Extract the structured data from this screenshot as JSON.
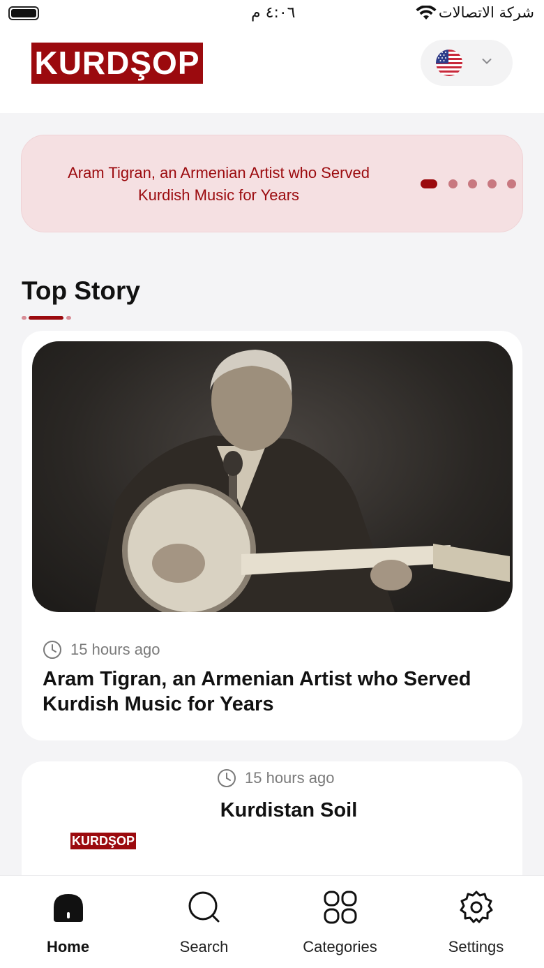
{
  "status_bar": {
    "time": "٤:٠٦ م",
    "carrier": "شركة الاتصالات"
  },
  "header": {
    "logo_text": "KURDŞOP",
    "language_flag": "us-flag-icon"
  },
  "banner": {
    "text": "Aram Tigran, an Armenian Artist who Served Kurdish Music for Years",
    "dots_count": 5,
    "active_dot": 0
  },
  "section": {
    "title": "Top Story"
  },
  "stories": [
    {
      "time": "15 hours ago",
      "title": "Aram Tigran, an Armenian Artist who Served Kurdish Music for Years"
    },
    {
      "time": "15 hours ago",
      "title": "Kurdistan Soil",
      "logo_text": "KURDŞOP"
    }
  ],
  "tabs": [
    {
      "label": "Home",
      "icon": "home-icon",
      "active": true
    },
    {
      "label": "Search",
      "icon": "search-icon",
      "active": false
    },
    {
      "label": "Categories",
      "icon": "categories-icon",
      "active": false
    },
    {
      "label": "Settings",
      "icon": "gear-icon",
      "active": false
    }
  ],
  "colors": {
    "brand": "#9b0a0e",
    "banner_bg": "#f5e0e2",
    "page_bg": "#f4f4f6"
  }
}
